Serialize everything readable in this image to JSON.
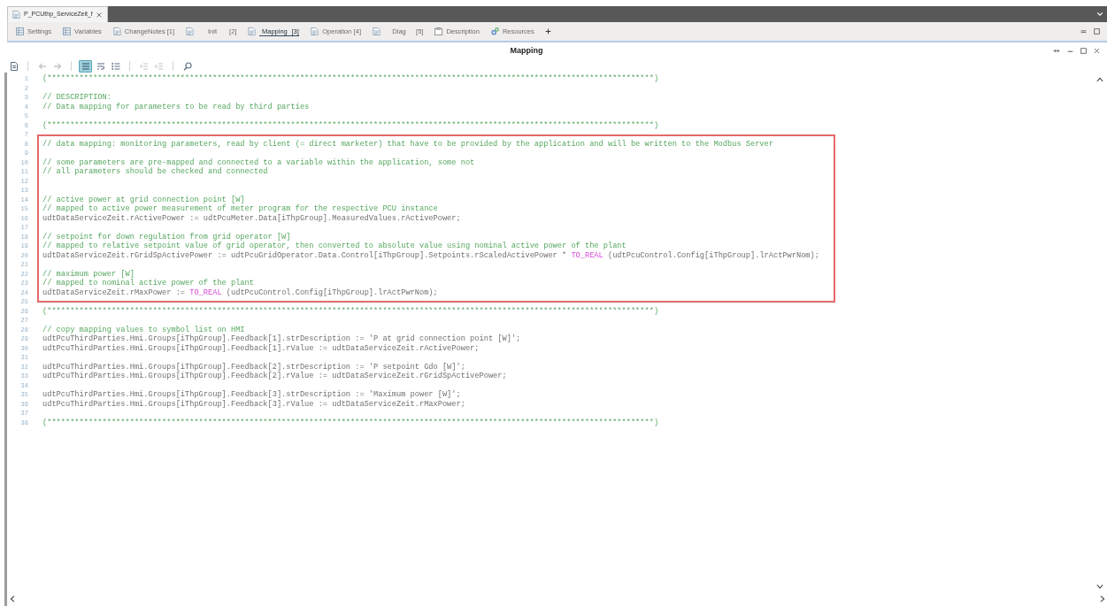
{
  "document_tabs": [
    {
      "title": "P_PCUthp_ServiceZeit_f",
      "selected": true
    }
  ],
  "view_tabs": [
    {
      "kind": "table",
      "label": "Settings",
      "selected": false
    },
    {
      "kind": "table",
      "label": "Variables",
      "selected": false
    },
    {
      "kind": "document",
      "label": "ChangeNotes",
      "count": "[1]",
      "selected": false
    },
    {
      "kind": "document",
      "label": "Init",
      "count": "[2]",
      "selected": false
    },
    {
      "kind": "document",
      "label": "Mapping",
      "count": "[3]",
      "selected": true
    },
    {
      "kind": "document",
      "label": "Operation",
      "count": "[4]",
      "selected": false
    },
    {
      "kind": "document",
      "label": "Diag",
      "count": "[5]",
      "selected": false
    },
    {
      "kind": "clipboard",
      "label": "Description",
      "selected": false
    },
    {
      "kind": "gears",
      "label": "Resources",
      "selected": false
    }
  ],
  "panel": {
    "title": "Mapping"
  },
  "toolbar": {
    "groups": [
      [
        {
          "kind": "document",
          "disabled": false,
          "selected": false
        }
      ],
      [
        {
          "kind": "back",
          "disabled": true,
          "selected": false
        },
        {
          "kind": "forward",
          "disabled": true,
          "selected": false
        }
      ],
      [
        {
          "kind": "outline",
          "disabled": false,
          "selected": true
        },
        {
          "kind": "wrap",
          "disabled": false,
          "selected": false
        },
        {
          "kind": "list",
          "disabled": false,
          "selected": false
        }
      ],
      [
        {
          "kind": "indent",
          "disabled": true,
          "selected": false
        },
        {
          "kind": "outdent",
          "disabled": true,
          "selected": false
        }
      ],
      [
        {
          "kind": "search",
          "disabled": false,
          "selected": false
        }
      ]
    ]
  },
  "editor": {
    "blocks": [
      {
        "highlighted": false,
        "lines": [
          {
            "number": "1",
            "segments": [
              {
                "kind": "comment",
                "text": "(************************************************************************************************************************************)"
              }
            ]
          },
          {
            "number": "2"
          },
          {
            "number": "3",
            "segments": [
              {
                "kind": "comment",
                "text": "// DESCRIPTION:"
              }
            ]
          },
          {
            "number": "4",
            "segments": [
              {
                "kind": "comment",
                "text": "// Data mapping for parameters to be read by third parties"
              }
            ]
          },
          {
            "number": "5"
          },
          {
            "number": "6",
            "segments": [
              {
                "kind": "comment",
                "text": "(************************************************************************************************************************************)"
              }
            ]
          },
          {
            "number": "7"
          }
        ]
      },
      {
        "highlighted": true,
        "lines": [
          {
            "number": "8",
            "segments": [
              {
                "kind": "comment",
                "text": "// data mapping: monitoring parameters, read by client (= direct marketer) that have to be provided by the application and will be written to the Modbus Server"
              }
            ]
          },
          {
            "number": "9"
          },
          {
            "number": "10",
            "segments": [
              {
                "kind": "comment",
                "text": "// some parameters are pre-mapped and connected to a variable within the application, some not"
              }
            ]
          },
          {
            "number": "11",
            "segments": [
              {
                "kind": "comment",
                "text": "// all parameters should be checked and connected"
              }
            ]
          },
          {
            "number": "12"
          },
          {
            "number": "13"
          },
          {
            "number": "14",
            "segments": [
              {
                "kind": "comment",
                "text": "// active power at grid connection point [W]"
              }
            ]
          },
          {
            "number": "15",
            "segments": [
              {
                "kind": "comment",
                "text": "// mapped to active power measurement of meter program for the respective PCU instance"
              }
            ]
          },
          {
            "number": "16",
            "segments": [
              {
                "kind": "code",
                "text": "udtDataServiceZeit.rActivePower := udtPcuMeter.Data[iThpGroup].MeasuredValues.rActivePower;"
              }
            ]
          },
          {
            "number": "17"
          },
          {
            "number": "18",
            "segments": [
              {
                "kind": "comment",
                "text": "// setpoint for down regulation from grid operator [W]"
              }
            ]
          },
          {
            "number": "19",
            "segments": [
              {
                "kind": "comment",
                "text": "// mapped to relative setpoint value of grid operator, then converted to absolute value using nominal active power of the plant"
              }
            ]
          },
          {
            "number": "20",
            "segments": [
              {
                "kind": "code",
                "text": "udtDataServiceZeit.rGridSpActivePower := udtPcuGridOperator.Data.Control[iThpGroup].Setpoints.rScaledActivePower * "
              },
              {
                "kind": "keyword",
                "text": "TO_REAL"
              },
              {
                "kind": "code",
                "text": " (udtPcuControl.Config[iThpGroup].lrActPwrNom);"
              }
            ]
          },
          {
            "number": "21"
          },
          {
            "number": "22",
            "segments": [
              {
                "kind": "comment",
                "text": "// maximum power [W]"
              }
            ]
          },
          {
            "number": "23",
            "segments": [
              {
                "kind": "comment",
                "text": "// mapped to nominal active power of the plant"
              }
            ]
          },
          {
            "number": "24",
            "segments": [
              {
                "kind": "code",
                "text": "udtDataServiceZeit.rMaxPower := "
              },
              {
                "kind": "keyword",
                "text": "TO_REAL"
              },
              {
                "kind": "code",
                "text": " (udtPcuControl.Config[iThpGroup].lrActPwrNom);"
              }
            ]
          }
        ]
      },
      {
        "highlighted": false,
        "lines": [
          {
            "number": "25"
          },
          {
            "number": "26",
            "segments": [
              {
                "kind": "comment",
                "text": "(************************************************************************************************************************************)"
              }
            ]
          },
          {
            "number": "27"
          },
          {
            "number": "28",
            "segments": [
              {
                "kind": "comment",
                "text": "// copy mapping values to symbol list on HMI"
              }
            ]
          },
          {
            "number": "29",
            "segments": [
              {
                "kind": "code",
                "text": "udtPcuThirdParties.Hmi.Groups[iThpGroup].Feedback[1].strDescription := 'P at grid connection point [W]';"
              }
            ]
          },
          {
            "number": "30",
            "segments": [
              {
                "kind": "code",
                "text": "udtPcuThirdParties.Hmi.Groups[iThpGroup].Feedback[1].rValue := udtDataServiceZeit.rActivePower;"
              }
            ]
          },
          {
            "number": "31"
          },
          {
            "number": "32",
            "segments": [
              {
                "kind": "code",
                "text": "udtPcuThirdParties.Hmi.Groups[iThpGroup].Feedback[2].strDescription := 'P setpoint Gdo [W]';"
              }
            ]
          },
          {
            "number": "33",
            "segments": [
              {
                "kind": "code",
                "text": "udtPcuThirdParties.Hmi.Groups[iThpGroup].Feedback[2].rValue := udtDataServiceZeit.rGridSpActivePower;"
              }
            ]
          },
          {
            "number": "34"
          },
          {
            "number": "35",
            "segments": [
              {
                "kind": "code",
                "text": "udtPcuThirdParties.Hmi.Groups[iThpGroup].Feedback[3].strDescription := 'Maximum power [W]';"
              }
            ]
          },
          {
            "number": "36",
            "segments": [
              {
                "kind": "code",
                "text": "udtPcuThirdParties.Hmi.Groups[iThpGroup].Feedback[3].rValue := udtDataServiceZeit.rMaxPower;"
              }
            ]
          },
          {
            "number": "37"
          },
          {
            "number": "38",
            "segments": [
              {
                "kind": "comment",
                "text": "(************************************************************************************************************************************)"
              }
            ]
          }
        ]
      }
    ]
  }
}
